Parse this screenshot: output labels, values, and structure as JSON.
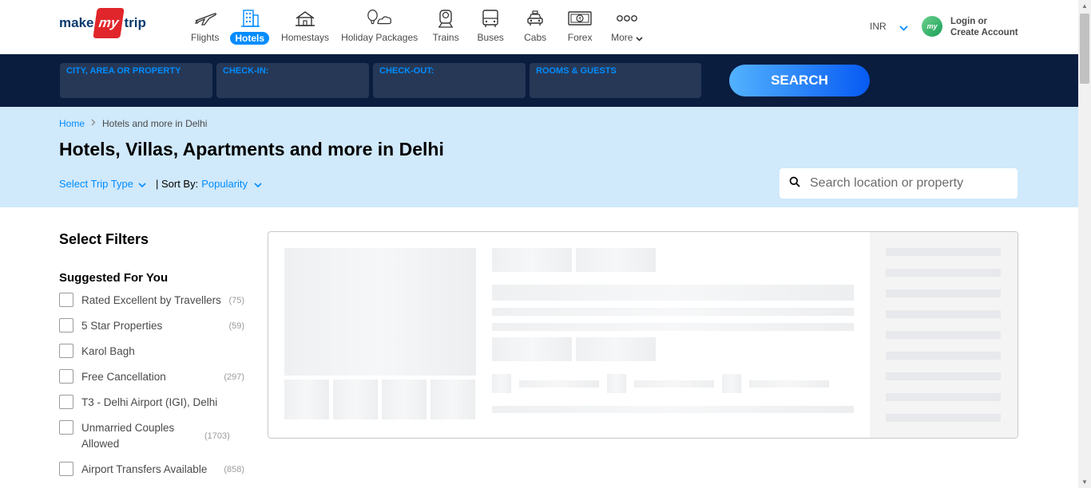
{
  "header": {
    "logo": {
      "make": "make",
      "my": "my",
      "trip": "trip"
    },
    "nav": [
      {
        "label": "Flights",
        "icon": "flight-icon",
        "active": false
      },
      {
        "label": "Hotels",
        "icon": "hotel-icon",
        "active": true
      },
      {
        "label": "Homestays",
        "icon": "homestay-icon",
        "active": false
      },
      {
        "label": "Holiday Packages",
        "icon": "holiday-icon",
        "active": false
      },
      {
        "label": "Trains",
        "icon": "train-icon",
        "active": false
      },
      {
        "label": "Buses",
        "icon": "bus-icon",
        "active": false
      },
      {
        "label": "Cabs",
        "icon": "cab-icon",
        "active": false
      },
      {
        "label": "Forex",
        "icon": "forex-icon",
        "active": false
      },
      {
        "label": "More",
        "icon": "more-icon",
        "active": false
      }
    ],
    "currency": "INR",
    "avatar_text": "my",
    "login_line1": "Login or",
    "login_line2": "Create Account"
  },
  "searchbar": {
    "city_label": "CITY, AREA OR PROPERTY",
    "checkin_label": "CHECK-IN:",
    "checkout_label": "CHECK-OUT:",
    "rooms_label": "ROOMS & GUESTS",
    "search_label": "SEARCH"
  },
  "listing": {
    "breadcrumb_home": "Home",
    "breadcrumb_current": "Hotels and more in Delhi",
    "title": "Hotels, Villas, Apartments and more in Delhi",
    "trip_type_label": "Select Trip Type",
    "sort_by_label": "| Sort By:",
    "sort_value": "Popularity",
    "search_placeholder": "Search location or property"
  },
  "filters": {
    "title": "Select Filters",
    "section_title": "Suggested For You",
    "items": [
      {
        "label": "Rated Excellent by Travellers",
        "count": "(75)"
      },
      {
        "label": "5 Star Properties",
        "count": "(59)"
      },
      {
        "label": "Karol Bagh",
        "count": ""
      },
      {
        "label": "Free Cancellation",
        "count": "(297)"
      },
      {
        "label": "T3 - Delhi Airport (IGI), Delhi",
        "count": ""
      },
      {
        "label": "Unmarried Couples Allowed",
        "count": "(1703)"
      },
      {
        "label": "Airport Transfers Available",
        "count": "(858)"
      }
    ]
  },
  "colors": {
    "accent": "#008cff",
    "navy": "#0a1d3f",
    "band": "#d0e9fb",
    "brand_red": "#e0262a"
  }
}
